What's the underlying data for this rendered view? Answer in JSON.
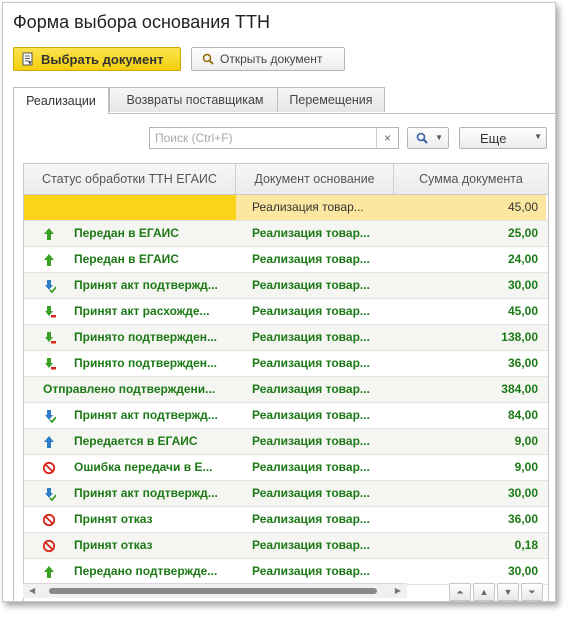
{
  "window": {
    "title": "Форма выбора основания ТТН"
  },
  "toolbar": {
    "select_label": "Выбрать документ",
    "open_label": "Открыть документ"
  },
  "tabs": [
    {
      "label": "Реализации",
      "active": true
    },
    {
      "label": "Возвраты поставщикам",
      "active": false
    },
    {
      "label": "Перемещения",
      "active": false
    }
  ],
  "search": {
    "placeholder": "Поиск (Ctrl+F)",
    "clear": "×",
    "more_label": "Еще"
  },
  "table": {
    "columns": [
      "Статус обработки ТТН ЕГАИС",
      "Документ основание",
      "Сумма документа"
    ],
    "rows": [
      {
        "icon": "",
        "status": "",
        "doc": "Реализация товар...",
        "sum": "45,00",
        "selected": true
      },
      {
        "icon": "arrow-up-green-icon",
        "status": "Передан в ЕГАИС",
        "doc": "Реализация товар...",
        "sum": "25,00"
      },
      {
        "icon": "arrow-up-green-icon",
        "status": "Передан в ЕГАИС",
        "doc": "Реализация товар...",
        "sum": "24,00"
      },
      {
        "icon": "arrow-down-blue-check-icon",
        "status": "Принят акт подтвержд...",
        "doc": "Реализация товар...",
        "sum": "30,00"
      },
      {
        "icon": "arrow-down-green-minus-icon",
        "status": "Принят акт расхожде...",
        "doc": "Реализация товар...",
        "sum": "45,00"
      },
      {
        "icon": "arrow-down-green-minus-icon",
        "status": "Принято подтвержден...",
        "doc": "Реализация товар...",
        "sum": "138,00"
      },
      {
        "icon": "arrow-down-green-minus-icon",
        "status": "Принято подтвержден...",
        "doc": "Реализация товар...",
        "sum": "36,00"
      },
      {
        "icon": "",
        "status": "Отправлено подтверждени...",
        "doc": "Реализация товар...",
        "sum": "384,00"
      },
      {
        "icon": "arrow-down-blue-check-icon",
        "status": "Принят акт подтвержд...",
        "doc": "Реализация товар...",
        "sum": "84,00"
      },
      {
        "icon": "arrow-up-blue-icon",
        "status": "Передается в ЕГАИС",
        "doc": "Реализация товар...",
        "sum": "9,00"
      },
      {
        "icon": "error-circle-icon",
        "status": "Ошибка передачи в Е...",
        "doc": "Реализация товар...",
        "sum": "9,00"
      },
      {
        "icon": "arrow-down-blue-check-icon",
        "status": "Принят акт подтвержд...",
        "doc": "Реализация товар...",
        "sum": "30,00"
      },
      {
        "icon": "error-circle-icon",
        "status": "Принят отказ",
        "doc": "Реализация товар...",
        "sum": "36,00"
      },
      {
        "icon": "error-circle-icon",
        "status": "Принят отказ",
        "doc": "Реализация товар...",
        "sum": "0,18"
      },
      {
        "icon": "arrow-up-green-icon",
        "status": "Передано подтвержде...",
        "doc": "Реализация товар...",
        "sum": "30,00"
      }
    ]
  },
  "colors": {
    "accent_yellow": "#f4cf0d",
    "status_green": "#1c7a16",
    "error_red": "#d9261c",
    "arrow_blue": "#2f7dc8"
  }
}
